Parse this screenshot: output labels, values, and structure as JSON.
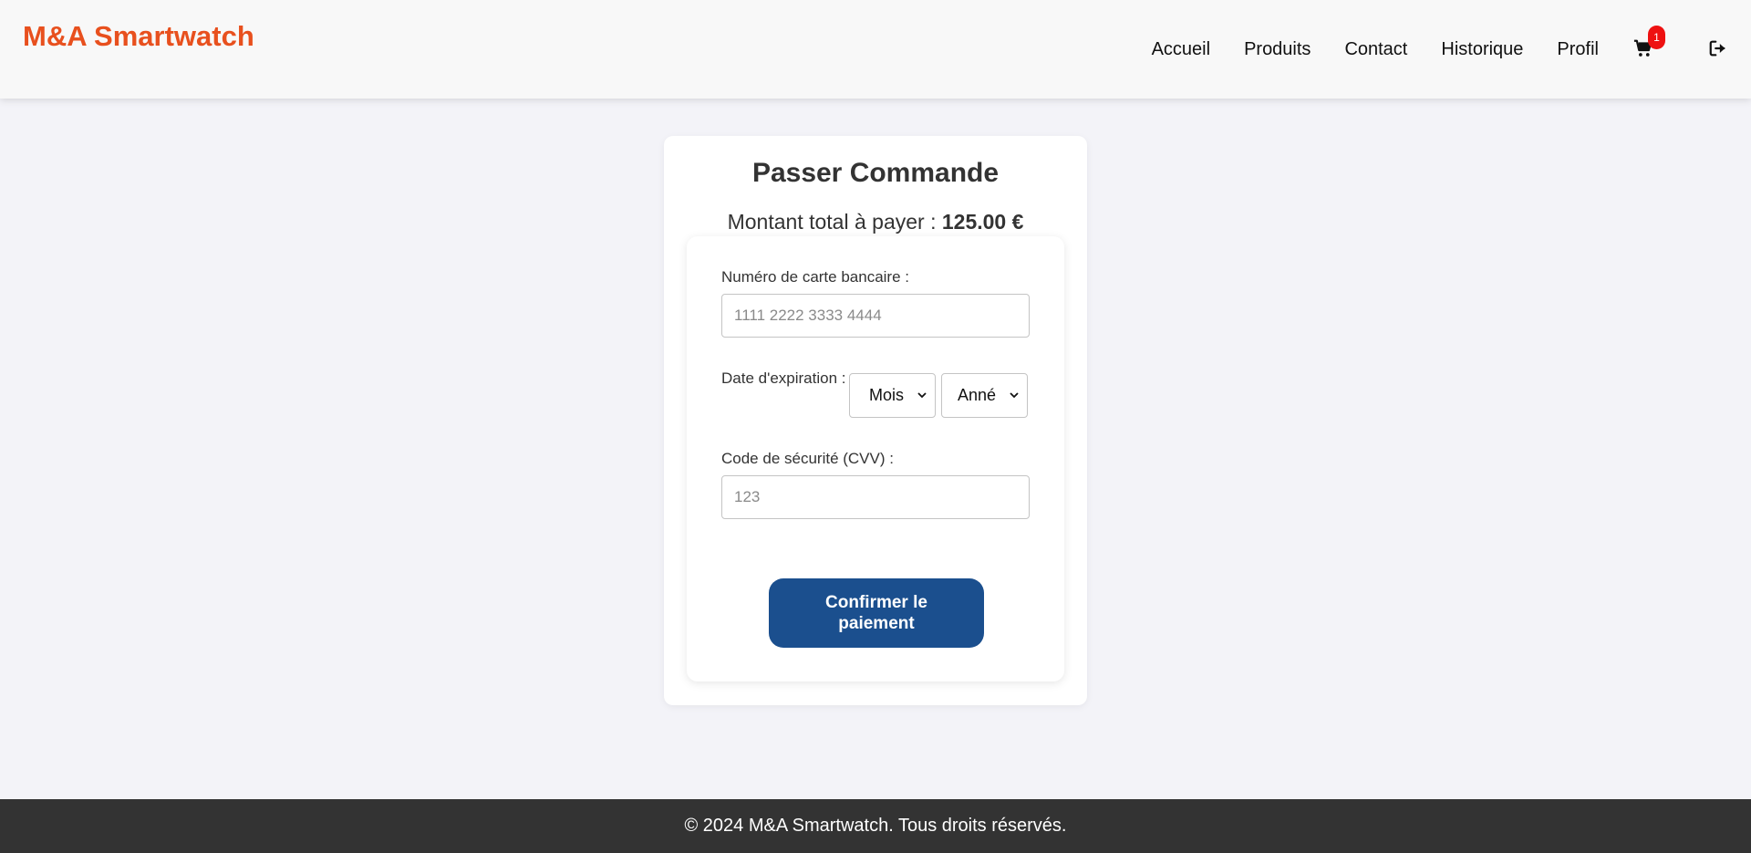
{
  "header": {
    "brand": "M&A Smartwatch",
    "nav": [
      {
        "label": "Accueil"
      },
      {
        "label": "Produits"
      },
      {
        "label": "Contact"
      },
      {
        "label": "Historique"
      },
      {
        "label": "Profil"
      }
    ],
    "cart_icon": "shopping-cart-icon",
    "cart_count": "1",
    "logout_icon": "sign-out-icon"
  },
  "order": {
    "title": "Passer Commande",
    "total_prefix": "Montant total à payer : ",
    "total_amount": "125.00 €",
    "card_number_label": "Numéro de carte bancaire :",
    "card_number_placeholder": "1111 2222 3333 4444",
    "card_number_value": "",
    "expiry_label": "Date d'expiration :",
    "month_selected": "Mois",
    "year_selected": "Année",
    "cvv_label": "Code de sécurité (CVV) :",
    "cvv_placeholder": "123",
    "cvv_value": "",
    "confirm_label": "Confirmer le paiement"
  },
  "footer": {
    "text": "© 2024 M&A Smartwatch. Tous droits réservés."
  },
  "colors": {
    "brand": "#e8501e",
    "primary_button": "#1b4f8e",
    "badge": "#ee1111",
    "footer_bg": "#333333",
    "page_bg": "#f3f3f8"
  }
}
